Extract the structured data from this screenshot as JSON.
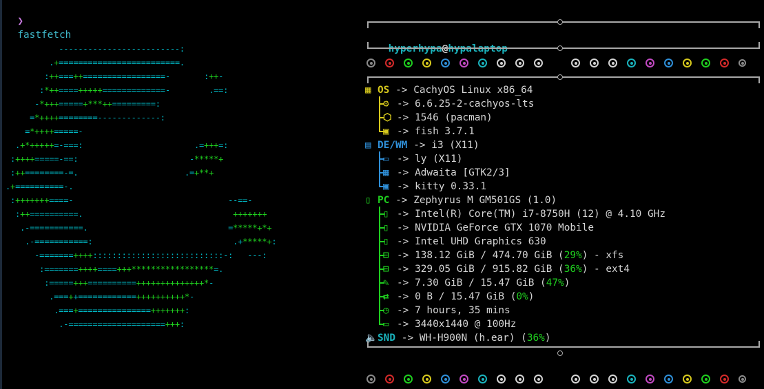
{
  "prompt": {
    "symbol": "❯",
    "command": "fastfetch"
  },
  "logo": {
    "lines": [
      {
        "parts": [
          {
            "t": "           -------------------------:",
            "c": "c"
          }
        ]
      },
      {
        "parts": [
          {
            "t": "         .",
            "c": "c"
          },
          {
            "t": "+",
            "c": "g"
          },
          {
            "t": "=========================.",
            "c": "c"
          }
        ]
      },
      {
        "parts": [
          {
            "t": "        :",
            "c": "c"
          },
          {
            "t": "++",
            "c": "g"
          },
          {
            "t": "===",
            "c": "c"
          },
          {
            "t": "++",
            "c": "g"
          },
          {
            "t": "=================-",
            "c": "c"
          },
          {
            "t": "       :",
            "c": "c"
          },
          {
            "t": "++",
            "c": "g"
          },
          {
            "t": "-",
            "c": "c"
          }
        ]
      },
      {
        "parts": [
          {
            "t": "       :",
            "c": "c"
          },
          {
            "t": "*++",
            "c": "g"
          },
          {
            "t": "====",
            "c": "c"
          },
          {
            "t": "+++++",
            "c": "g"
          },
          {
            "t": "=============-",
            "c": "c"
          },
          {
            "t": "        .==:",
            "c": "c"
          }
        ]
      },
      {
        "parts": [
          {
            "t": "      -",
            "c": "c"
          },
          {
            "t": "*+++",
            "c": "g"
          },
          {
            "t": "=====",
            "c": "c"
          },
          {
            "t": "+***++",
            "c": "g"
          },
          {
            "t": "=========:",
            "c": "c"
          }
        ]
      },
      {
        "parts": [
          {
            "t": "     =",
            "c": "c"
          },
          {
            "t": "*++++",
            "c": "g"
          },
          {
            "t": "========-------------:",
            "c": "c"
          }
        ]
      },
      {
        "parts": [
          {
            "t": "    =",
            "c": "c"
          },
          {
            "t": "*++++",
            "c": "g"
          },
          {
            "t": "=====-",
            "c": "c"
          }
        ]
      },
      {
        "parts": [
          {
            "t": "  .",
            "c": "c"
          },
          {
            "t": "+*+++++",
            "c": "g"
          },
          {
            "t": "=-===:",
            "c": "c"
          },
          {
            "t": "                       .=",
            "c": "c"
          },
          {
            "t": "+++",
            "c": "g"
          },
          {
            "t": "=:",
            "c": "c"
          }
        ]
      },
      {
        "parts": [
          {
            "t": " :",
            "c": "c"
          },
          {
            "t": "++++",
            "c": "g"
          },
          {
            "t": "=====-==:",
            "c": "c"
          },
          {
            "t": "                       -",
            "c": "c"
          },
          {
            "t": "*****+",
            "c": "g"
          }
        ]
      },
      {
        "parts": [
          {
            "t": " :",
            "c": "c"
          },
          {
            "t": "++",
            "c": "g"
          },
          {
            "t": "========-=.",
            "c": "c"
          },
          {
            "t": "                      .=",
            "c": "c"
          },
          {
            "t": "+**+",
            "c": "g"
          }
        ]
      },
      {
        "parts": [
          {
            "t": ".",
            "c": "c"
          },
          {
            "t": "+",
            "c": "g"
          },
          {
            "t": "==========-.",
            "c": "c"
          }
        ]
      },
      {
        "parts": [
          {
            "t": " :",
            "c": "c"
          },
          {
            "t": "+++++++",
            "c": "g"
          },
          {
            "t": "====-",
            "c": "c"
          },
          {
            "t": "                                --==-",
            "c": "c"
          }
        ]
      },
      {
        "parts": [
          {
            "t": "  :",
            "c": "c"
          },
          {
            "t": "++",
            "c": "g"
          },
          {
            "t": "==========.",
            "c": "c"
          },
          {
            "t": "                               +++++++",
            "c": "g"
          }
        ]
      },
      {
        "parts": [
          {
            "t": "   .-===========.",
            "c": "c"
          },
          {
            "t": "                             =",
            "c": "c"
          },
          {
            "t": "*****+*+",
            "c": "g"
          }
        ]
      },
      {
        "parts": [
          {
            "t": "    .-===========:",
            "c": "c"
          },
          {
            "t": "                             .+",
            "c": "c"
          },
          {
            "t": "*****+",
            "c": "g"
          },
          {
            "t": ":",
            "c": "c"
          }
        ]
      },
      {
        "parts": [
          {
            "t": "      -=======",
            "c": "c"
          },
          {
            "t": "++++",
            "c": "g"
          },
          {
            "t": ":::::::::::::::::::::::::::-:",
            "c": "c"
          },
          {
            "t": "   ---:",
            "c": "c"
          }
        ]
      },
      {
        "parts": [
          {
            "t": "       :=======",
            "c": "c"
          },
          {
            "t": "++++",
            "c": "g"
          },
          {
            "t": "====",
            "c": "c"
          },
          {
            "t": "+++*****************",
            "c": "g"
          },
          {
            "t": "=.",
            "c": "c"
          }
        ]
      },
      {
        "parts": [
          {
            "t": "        :=====",
            "c": "c"
          },
          {
            "t": "+++",
            "c": "g"
          },
          {
            "t": "==========",
            "c": "c"
          },
          {
            "t": "++++++++++++++*",
            "c": "g"
          },
          {
            "t": "-",
            "c": "c"
          }
        ]
      },
      {
        "parts": [
          {
            "t": "         .===",
            "c": "c"
          },
          {
            "t": "+",
            "c": "g"
          },
          {
            "t": "+============",
            "c": "c"
          },
          {
            "t": "++++++++++*",
            "c": "g"
          },
          {
            "t": "-",
            "c": "c"
          }
        ]
      },
      {
        "parts": [
          {
            "t": "          .===",
            "c": "c"
          },
          {
            "t": "+",
            "c": "g"
          },
          {
            "t": "===============",
            "c": "c"
          },
          {
            "t": "+++++++",
            "c": "g"
          },
          {
            "t": ":",
            "c": "c"
          }
        ]
      },
      {
        "parts": [
          {
            "t": "           .-====================",
            "c": "c"
          },
          {
            "t": "+++",
            "c": "g"
          },
          {
            "t": ":",
            "c": "c"
          }
        ]
      }
    ]
  },
  "header": {
    "user": "hyperhypa",
    "at": "@",
    "host": "hypalaptop"
  },
  "palette_dots": {
    "row_a": [
      "#8a8a8a",
      "#d42a2a",
      "#1fcf1f",
      "#d7c91d",
      "#2f8fd8",
      "#c34ac3",
      "#1ab3bd",
      "#d4d4d4",
      "#d4d4d4",
      "#d4d4d4"
    ],
    "row_b": [
      "#d4d4d4",
      "#d4d4d4",
      "#d4d4d4",
      "#1ab3bd",
      "#c34ac3",
      "#2f8fd8",
      "#d7c91d",
      "#1fcf1f",
      "#d42a2a",
      "#8a8a8a"
    ]
  },
  "info": {
    "os": {
      "key": "OS",
      "arrow": "->",
      "value": "CachyOS Linux x86_64"
    },
    "kernel": {
      "arrow": "->",
      "value": "6.6.25-2-cachyos-lts"
    },
    "packages": {
      "arrow": "->",
      "value": "1546 (pacman)"
    },
    "shell": {
      "arrow": "->",
      "value": "fish 3.7.1"
    },
    "dewm": {
      "key": "DE/WM",
      "arrow": "->",
      "value": "i3 (X11)"
    },
    "lm": {
      "arrow": "->",
      "value": "ly (X11)"
    },
    "theme": {
      "arrow": "->",
      "value": "Adwaita [GTK2/3]"
    },
    "terminal": {
      "arrow": "->",
      "value": "kitty 0.33.1"
    },
    "pc": {
      "key": "PC",
      "arrow": "->",
      "value": "Zephyrus M GM501GS (1.0)"
    },
    "cpu": {
      "arrow": "->",
      "value": "Intel(R) Core(TM) i7-8750H (12) @ 4.10 GHz"
    },
    "gpu1": {
      "arrow": "->",
      "value": "NVIDIA GeForce GTX 1070 Mobile"
    },
    "gpu2": {
      "arrow": "->",
      "value": "Intel UHD Graphics 630"
    },
    "disk1": {
      "arrow": "->",
      "prefix": "138.12 GiB / 474.70 GiB (",
      "pct": "29%",
      "suffix": ") - xfs"
    },
    "disk2": {
      "arrow": "->",
      "prefix": "329.05 GiB / 915.82 GiB (",
      "pct": "36%",
      "suffix": ") - ext4"
    },
    "memory": {
      "arrow": "->",
      "prefix": "7.30 GiB / 15.47 GiB (",
      "pct": "47%",
      "suffix": ")"
    },
    "swap": {
      "arrow": "->",
      "prefix": "0 B / 15.47 GiB (",
      "pct": "0%",
      "suffix": ")"
    },
    "uptime": {
      "arrow": "->",
      "value": "7 hours, 35 mins"
    },
    "display": {
      "arrow": "->",
      "value": "3440x1440 @ 100Hz"
    },
    "sound": {
      "key": "SND",
      "arrow": "->",
      "prefix": "WH-H900N (h.ear) (",
      "pct": "36%",
      "suffix": ")"
    }
  },
  "colors": {
    "os_group": "#d7c91d",
    "de_group": "#2f8fd8",
    "pc_group": "#1fcf1f",
    "snd_group": "#1ab3bd",
    "accent": "#1ab3bd"
  },
  "icons": [
    "os-grid-icon",
    "gear-icon",
    "package-icon",
    "shell-icon",
    "window-icon",
    "monitor-icon",
    "palette-grid-icon",
    "terminal-icon",
    "chip-icon",
    "cpu-icon",
    "gpu-icon",
    "gpu-icon",
    "disk-icon",
    "disk-icon",
    "memory-icon",
    "swap-icon",
    "clock-icon",
    "display-icon",
    "speaker-icon"
  ]
}
